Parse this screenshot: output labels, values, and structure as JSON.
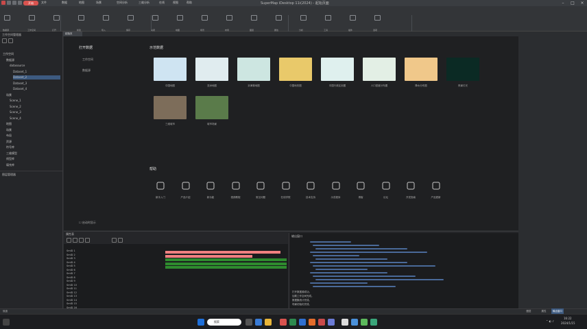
{
  "app": {
    "title": "SuperMap iDesktop 11i(2024) - 起始页面",
    "accent": "#d9534f"
  },
  "menu": {
    "active": "开始",
    "items": [
      "文件",
      "开始",
      "数据",
      "地图",
      "场景",
      "空间分析",
      "三维分析",
      "在线",
      "视图",
      "帮助"
    ]
  },
  "ribbon": {
    "buttons": [
      "数据源",
      "工作空间",
      "打开",
      "新建",
      "导入",
      "保存",
      "关闭",
      "地图",
      "场景",
      "布局",
      "图层",
      "属性",
      "分析",
      "工具",
      "插件",
      "选项"
    ],
    "groups": [
      "工作空间",
      "数据",
      "浏览",
      "工具"
    ]
  },
  "doc_tab": "起始页",
  "workspace": {
    "panel_title": "工作空间管理器",
    "tree": [
      {
        "label": "工作空间",
        "level": 0
      },
      {
        "label": "数据源",
        "level": 1
      },
      {
        "label": "datasource",
        "level": 2
      },
      {
        "label": "Dataset_1",
        "level": 3
      },
      {
        "label": "Dataset_2",
        "level": 3,
        "selected": true
      },
      {
        "label": "Dataset_3",
        "level": 3
      },
      {
        "label": "Dataset_4",
        "level": 3
      },
      {
        "label": "场景",
        "level": 1
      },
      {
        "label": "Scene_1",
        "level": 2
      },
      {
        "label": "Scene_2",
        "level": 2
      },
      {
        "label": "Scene_3",
        "level": 2
      },
      {
        "label": "Scene_4",
        "level": 2
      },
      {
        "label": "地图",
        "level": 1
      },
      {
        "label": "场景",
        "level": 1
      },
      {
        "label": "布局",
        "level": 1
      },
      {
        "label": "资源",
        "level": 1
      },
      {
        "label": "符号库",
        "level": 1
      },
      {
        "label": "三维模型",
        "level": 1
      },
      {
        "label": "线型库",
        "level": 1
      },
      {
        "label": "填充库",
        "level": 1
      }
    ],
    "layer_panel_title": "图层管理器"
  },
  "start": {
    "open_title": "打开数据",
    "recent": [
      "工作空间",
      "数据源"
    ],
    "samples_title": "示范数据",
    "samples": [
      {
        "label": "中国地图",
        "color": "#cfe4f2"
      },
      {
        "label": "亚洲地图",
        "color": "#e0ecef"
      },
      {
        "label": "京津冀地图",
        "color": "#cde6e1"
      },
      {
        "label": "中国地形图",
        "color": "#e9c96a"
      },
      {
        "label": "中国行政区划图",
        "color": "#dff0ee"
      },
      {
        "label": "人口密度分布图",
        "color": "#e3efe5"
      },
      {
        "label": "降水分布图",
        "color": "#f0c88a"
      },
      {
        "label": "夜景灯光",
        "color": "#0b2a24"
      },
      {
        "label": "三维城市",
        "color": "#7d6d5a"
      },
      {
        "label": "城市场景",
        "color": "#5a7b4a"
      }
    ],
    "help_title": "帮助",
    "help": [
      {
        "label": "新手入门",
        "icon": "wand-icon"
      },
      {
        "label": "产品介绍",
        "icon": "book-icon"
      },
      {
        "label": "新功能",
        "icon": "send-icon"
      },
      {
        "label": "视频教程",
        "icon": "video-icon"
      },
      {
        "label": "常见问题",
        "icon": "question-icon"
      },
      {
        "label": "在线学院",
        "icon": "graduation-icon"
      },
      {
        "label": "技术支持",
        "icon": "monitor-icon"
      },
      {
        "label": "示范程序",
        "icon": "chat-icon"
      },
      {
        "label": "博客",
        "icon": "document-icon"
      },
      {
        "label": "论坛",
        "icon": "message-icon"
      },
      {
        "label": "开发指南",
        "icon": "calendar-icon"
      },
      {
        "label": "产品更新",
        "icon": "update-icon"
      }
    ],
    "show_on_startup": "启动时显示"
  },
  "attribute": {
    "title": "属性表",
    "rows": [
      "SmID 1",
      "SmID 2",
      "SmID 3",
      "SmID 4",
      "SmID 5",
      "SmID 6",
      "SmID 7",
      "SmID 8",
      "SmID 9",
      "SmID 10",
      "SmID 11",
      "SmID 12",
      "SmID 13",
      "SmID 14",
      "SmID 15",
      "SmID 16"
    ],
    "bars": [
      {
        "value": 0.95,
        "color": "#f08080"
      },
      {
        "value": 0.72,
        "color": "#f08080"
      },
      {
        "value": 1.0,
        "color": "#2e8b2e"
      },
      {
        "value": 1.0,
        "color": "#2e8b2e"
      },
      {
        "value": 1.0,
        "color": "#2e8b2e"
      }
    ]
  },
  "console": {
    "title": "输出窗口",
    "lines": [
      "打开数据源成功。",
      "加载工作空间完成。",
      "数据集统计完成。",
      "场景初始化完成。"
    ]
  },
  "status": {
    "left": "就绪",
    "tabs": [
      "图层",
      "属性",
      "输出窗口"
    ]
  },
  "taskbar": {
    "search": "搜索",
    "time": "16:22",
    "date": "2024/1/15"
  }
}
